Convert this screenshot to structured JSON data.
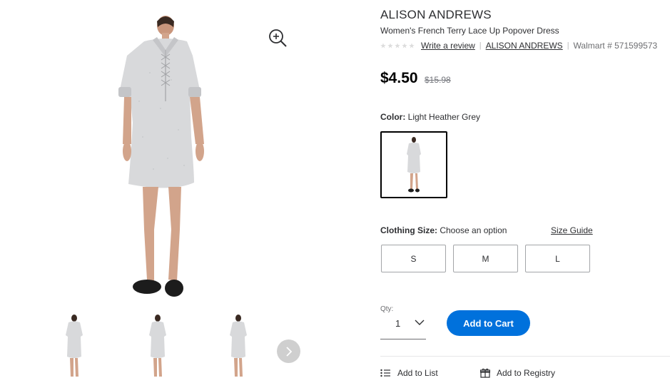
{
  "product": {
    "brand": "ALISON ANDREWS",
    "title": "Women's French Terry Lace Up Popover Dress",
    "rating_stars": 5,
    "write_review": "Write a review",
    "brand_link": "ALISON ANDREWS",
    "walmart_id": "Walmart # 571599573"
  },
  "pricing": {
    "price": "$4.50",
    "was_price": "$15.98"
  },
  "color": {
    "label": "Color:",
    "value": "Light Heather Grey"
  },
  "size": {
    "label": "Clothing Size:",
    "value": "Choose an option",
    "guide": "Size Guide",
    "options": [
      "S",
      "M",
      "L"
    ]
  },
  "quantity": {
    "label": "Qty:",
    "value": "1"
  },
  "actions": {
    "add_to_cart": "Add to Cart",
    "add_to_list": "Add to List",
    "add_to_registry": "Add to Registry"
  },
  "colors": {
    "primary_blue": "#0071dc",
    "text": "#2e2f32",
    "dress": "#d8d9db",
    "shoe": "#1c1c1c"
  }
}
